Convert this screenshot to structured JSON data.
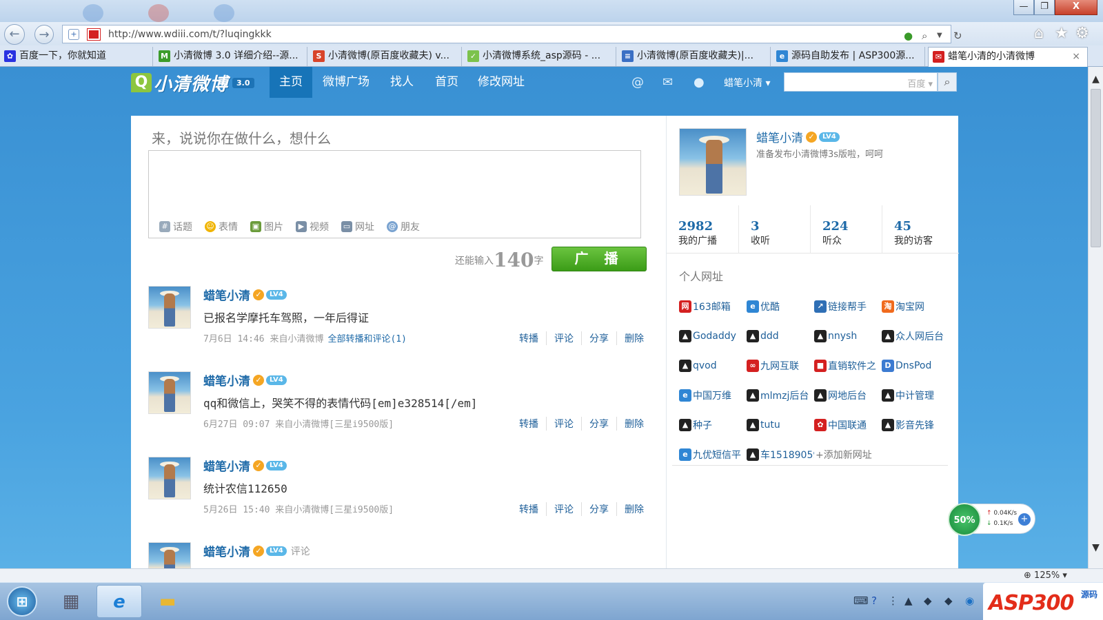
{
  "browser": {
    "url": "http://www.wdiii.com/t/?luqingkkk",
    "window_buttons": {
      "minimize": "—",
      "restore": "❐",
      "close": "X"
    },
    "tabs": [
      {
        "label": "百度一下，你就知道",
        "icon": "baidu-paw-icon",
        "color": "#2932e1"
      },
      {
        "label": "小清微博 3.0 详细介绍--源...",
        "icon": "m-icon",
        "color": "#3c9c2a"
      },
      {
        "label": "小清微博(原百度收藏夫) v...",
        "icon": "s-icon",
        "color": "#d8442a"
      },
      {
        "label": "小清微博系统_asp源码 - ...",
        "icon": "leaf-icon",
        "color": "#7cc24c"
      },
      {
        "label": "小清微博(原百度收藏夫)|...",
        "icon": "doc-icon",
        "color": "#3a6fc4"
      },
      {
        "label": "源码自助发布 | ASP300源...",
        "icon": "ie-icon",
        "color": "#2f86d4"
      },
      {
        "label": "蜡笔小清的小清微博",
        "icon": "mail-icon",
        "color": "#d42020",
        "active": true
      }
    ],
    "tab_close": "×",
    "zoom": "125%"
  },
  "site": {
    "logo_letter": "Q",
    "logo_name": "小清微博",
    "version": "3.0",
    "nav": [
      "主页",
      "微博广场",
      "找人",
      "首页",
      "修改网址"
    ],
    "user_menu": "蜡笔小清",
    "search_engine": "百度"
  },
  "compose": {
    "prompt": "来，说说你在做什么，想什么",
    "tools": [
      {
        "label": "话题",
        "icon": "topic-icon",
        "color": "#9ab"
      },
      {
        "label": "表情",
        "icon": "smiley-icon",
        "color": "#f0b400"
      },
      {
        "label": "图片",
        "icon": "image-icon",
        "color": "#6a9b3a"
      },
      {
        "label": "视频",
        "icon": "video-icon",
        "color": "#7a8fa6"
      },
      {
        "label": "网址",
        "icon": "url-icon",
        "color": "#7a8fa6"
      },
      {
        "label": "朋友",
        "icon": "at-icon",
        "color": "#7aa3d0"
      }
    ],
    "counter_prefix": "还能输入",
    "counter_value": "140",
    "counter_suffix": "字",
    "submit": "广 播"
  },
  "feed": [
    {
      "name": "蜡笔小清",
      "level": "LV4",
      "text": "已报名学摩托车驾照，一年后得证",
      "meta": "7月6日 14:46 来自小清微博",
      "extra": "全部转播和评论(1)",
      "actions": [
        "转播",
        "评论",
        "分享",
        "删除"
      ]
    },
    {
      "name": "蜡笔小清",
      "level": "LV4",
      "text": "qq和微信上，哭笑不得的表情代码[em]e328514[/em]",
      "meta": "6月27日 09:07 来自小清微博[三星i9500版]",
      "extra": "",
      "actions": [
        "转播",
        "评论",
        "分享",
        "删除"
      ]
    },
    {
      "name": "蜡笔小清",
      "level": "LV4",
      "text": "统计农信112650",
      "meta": "5月26日 15:40 来自小清微博[三星i9500版]",
      "extra": "",
      "actions": [
        "转播",
        "评论",
        "分享",
        "删除"
      ]
    },
    {
      "name": "蜡笔小清",
      "level": "LV4",
      "text": "",
      "meta": "",
      "extra": "评论",
      "actions": []
    }
  ],
  "profile": {
    "name": "蜡笔小清",
    "level": "LV4",
    "bio": "准备发布小清微博3s版啦，呵呵",
    "stats": [
      {
        "num": "2982",
        "label": "我的广播"
      },
      {
        "num": "3",
        "label": "收听"
      },
      {
        "num": "224",
        "label": "听众"
      },
      {
        "num": "45",
        "label": "我的访客"
      }
    ]
  },
  "links": {
    "title": "个人网址",
    "rows": [
      [
        {
          "label": "163邮箱",
          "icon": "163-icon",
          "color": "#d42020"
        },
        {
          "label": "优酷",
          "icon": "ie-icon",
          "color": "#2f86d4"
        },
        {
          "label": "链接帮手",
          "icon": "link-icon",
          "color": "#2f6fb5"
        },
        {
          "label": "淘宝网",
          "icon": "taobao-icon",
          "color": "#f06a1d"
        }
      ],
      [
        {
          "label": "Godaddy",
          "icon": "tux-icon",
          "color": "#222"
        },
        {
          "label": "ddd",
          "icon": "tux-icon",
          "color": "#222"
        },
        {
          "label": "nnysh",
          "icon": "tux-icon",
          "color": "#222"
        },
        {
          "label": "众人网后台",
          "icon": "tux-icon",
          "color": "#222"
        }
      ],
      [
        {
          "label": "qvod",
          "icon": "tux-icon",
          "color": "#222"
        },
        {
          "label": "九网互联",
          "icon": "swirl-icon",
          "color": "#d42020"
        },
        {
          "label": "直销软件之",
          "icon": "red-icon",
          "color": "#d42020"
        },
        {
          "label": "DnsPod",
          "icon": "dnspod-icon",
          "color": "#3c7bd1"
        }
      ],
      [
        {
          "label": "中国万维",
          "icon": "ie-icon",
          "color": "#2f86d4"
        },
        {
          "label": "mlmzj后台",
          "icon": "tux-icon",
          "color": "#222"
        },
        {
          "label": "网地后台",
          "icon": "tux-icon",
          "color": "#222"
        },
        {
          "label": "中计管理",
          "icon": "tux-icon",
          "color": "#222"
        }
      ],
      [
        {
          "label": "种子",
          "icon": "tux-icon",
          "color": "#222"
        },
        {
          "label": "tutu",
          "icon": "tux-icon",
          "color": "#222"
        },
        {
          "label": "中国联通",
          "icon": "unicom-icon",
          "color": "#d42020"
        },
        {
          "label": "影音先锋",
          "icon": "tux-icon",
          "color": "#222"
        }
      ],
      [
        {
          "label": "九优短信平",
          "icon": "ie-icon",
          "color": "#2f86d4"
        },
        {
          "label": "车15189059",
          "icon": "tux-icon",
          "color": "#222"
        }
      ]
    ],
    "add": "+添加新网址"
  },
  "speed_widget": {
    "percent": "50%",
    "up": "0.04K/s",
    "down": "0.1K/s"
  },
  "watermark": {
    "asp": "ASP300",
    "yuan": "源码"
  }
}
